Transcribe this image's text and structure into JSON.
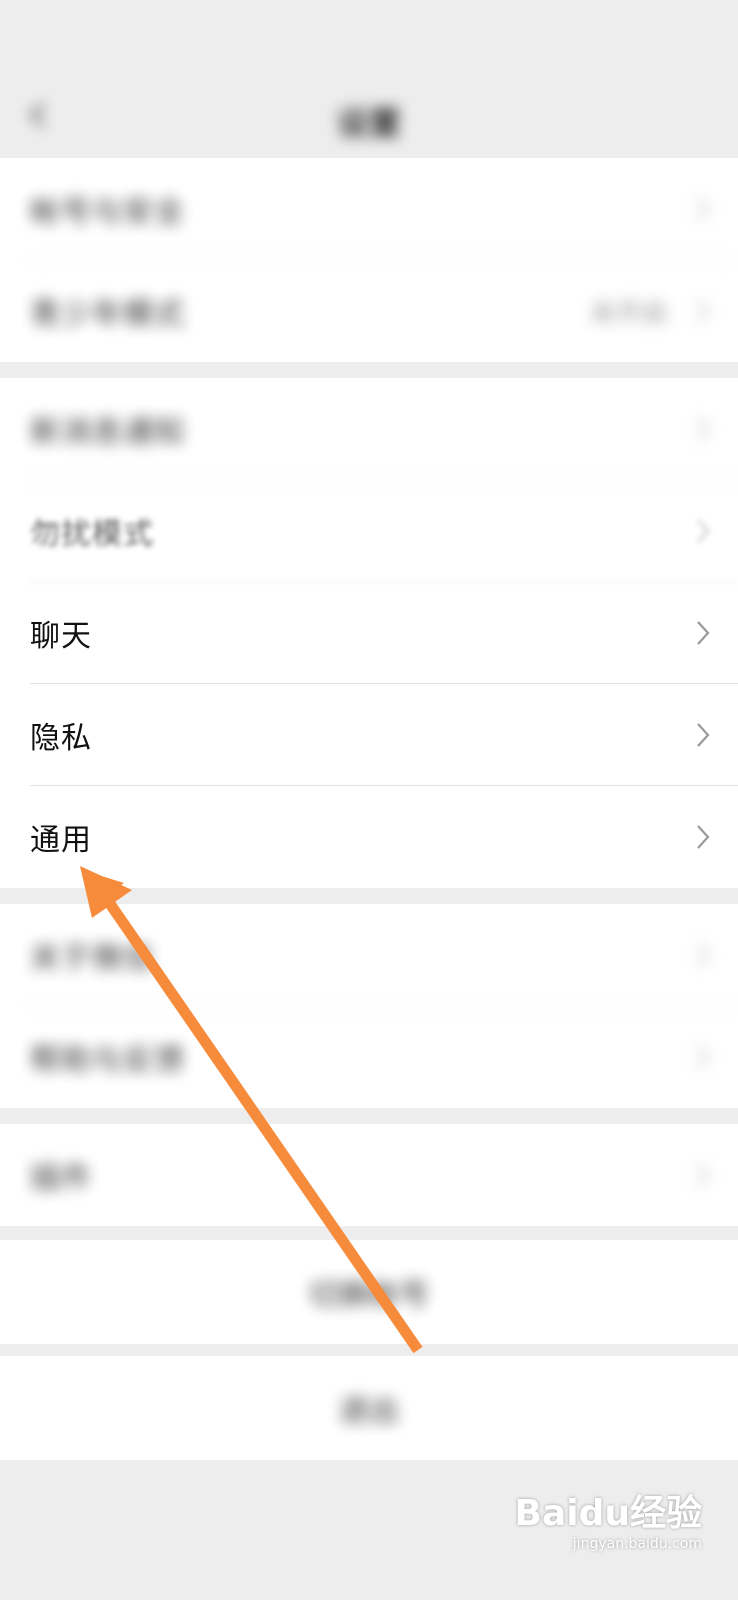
{
  "status_bar": {
    "left_text": "",
    "right_text": ""
  },
  "nav": {
    "title": "设置"
  },
  "groups": [
    {
      "items": [
        {
          "label": "帐号与安全"
        },
        {
          "label": "青少年模式",
          "value": "未开启"
        }
      ]
    },
    {
      "items": [
        {
          "label": "新消息通知"
        },
        {
          "label": "勿扰模式"
        },
        {
          "label": "聊天"
        },
        {
          "label": "隐私"
        },
        {
          "label": "通用"
        }
      ]
    },
    {
      "items": [
        {
          "label": "关于微信"
        },
        {
          "label": "帮助与反馈"
        }
      ]
    },
    {
      "items": [
        {
          "label": "插件"
        }
      ]
    }
  ],
  "actions": {
    "switch_account": "切换帐号",
    "logout": "退出"
  },
  "annotation": {
    "arrow_color": "#f68b3c"
  },
  "watermark": {
    "brand": "Baidu经验",
    "url": "jingyan.baidu.com"
  }
}
